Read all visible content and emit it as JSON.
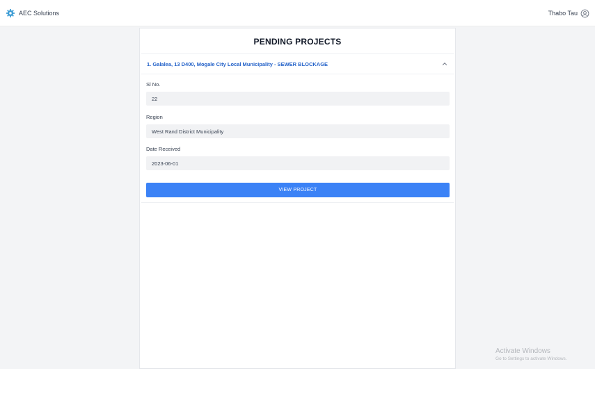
{
  "header": {
    "brand_name": "AEC Solutions",
    "brand_color": "#3b9bd4",
    "user_name": "Thabo Tau"
  },
  "page": {
    "title": "PENDING PROJECTS"
  },
  "project": {
    "title": "1. Galalea, 13 D400, Mogale City Local Municipality - SEWER BLOCKAGE",
    "expanded": true,
    "fields": {
      "sl_no_label": "Sl No.",
      "sl_no_value": "22",
      "region_label": "Region",
      "region_value": "West Rand District Municipality",
      "date_label": "Date Received",
      "date_value": "2023-06-01"
    },
    "view_button_label": "VIEW PROJECT",
    "button_color": "#3b82f6",
    "title_color": "#2563c9"
  },
  "watermark": {
    "title": "Activate Windows",
    "subtitle": "Go to Settings to activate Windows."
  },
  "icons": {
    "brand": "gear-icon",
    "user": "user-circle-icon",
    "accordion": "chevron-up-icon"
  }
}
